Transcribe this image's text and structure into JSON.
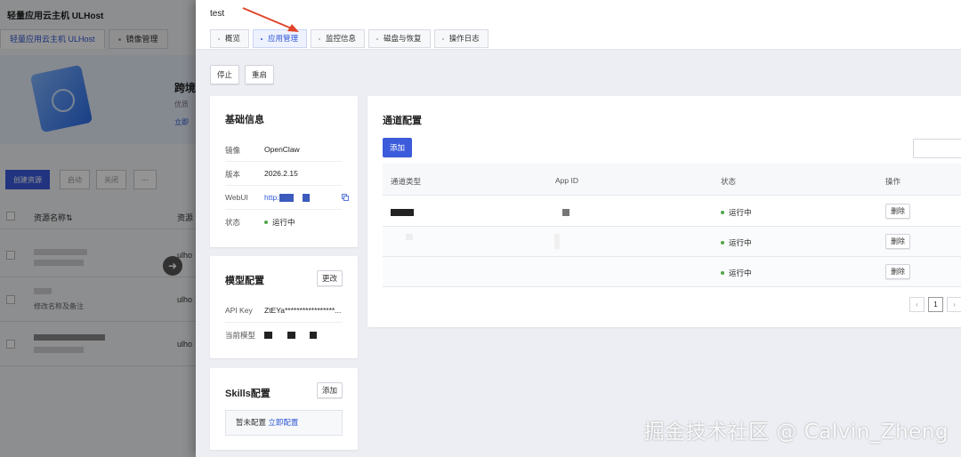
{
  "background": {
    "app_title": "轻量应用云主机 ULHost",
    "tabs": [
      "轻量应用云主机 ULHost",
      "镜像管理"
    ],
    "banner": {
      "title": "跨境",
      "subtitle": "优质",
      "link": "立即"
    },
    "buttons": {
      "create": "创建资源",
      "start": "启动",
      "stop": "关闭",
      "more": "···"
    },
    "table": {
      "col_name": "资源名称",
      "col_sort_icon": "⇅",
      "col_second": "资源",
      "row_values": [
        "ulho",
        "ulho",
        "ulho"
      ],
      "row_subtexts": [
        "",
        "修改名称及备注",
        ""
      ]
    }
  },
  "drawer": {
    "title": "test",
    "tabs": [
      {
        "label": "概览",
        "active": false
      },
      {
        "label": "应用管理",
        "active": true
      },
      {
        "label": "监控信息",
        "active": false
      },
      {
        "label": "磁盘与恢复",
        "active": false
      },
      {
        "label": "操作日志",
        "active": false
      }
    ],
    "actions": {
      "stop": "停止",
      "restart": "重启"
    },
    "basic_info": {
      "title": "基础信息",
      "rows": [
        {
          "key": "镜像",
          "value": "OpenClaw"
        },
        {
          "key": "版本",
          "value": "2026.2.15"
        },
        {
          "key": "WebUI",
          "value": "http:"
        },
        {
          "key": "状态",
          "value": "运行中"
        }
      ]
    },
    "model_config": {
      "title": "模型配置",
      "edit_button": "更改",
      "rows": [
        {
          "key": "API Key",
          "value": "ZtEYa*****************..."
        },
        {
          "key": "当前模型",
          "value": ""
        }
      ]
    },
    "skills_config": {
      "title": "Skills配置",
      "add_button": "添加",
      "empty_text": "暂未配置",
      "empty_link": "立即配置"
    },
    "channel_config": {
      "title": "通道配置",
      "add_button": "添加",
      "columns": [
        "通道类型",
        "App ID",
        "状态",
        "操作"
      ],
      "rows": [
        {
          "status": "运行中",
          "action": "删除"
        },
        {
          "status": "运行中",
          "action": "删除"
        },
        {
          "status": "运行中",
          "action": "删除"
        }
      ],
      "pagination": {
        "prev": "‹",
        "current": "1",
        "next": "›"
      }
    }
  },
  "watermark": "掘金技术社区 @ Calvin_Zheng",
  "colors": {
    "primary": "#3b5bdb",
    "link": "#2f57d3",
    "status_green": "#52a64a",
    "arrow_red": "#e0452b"
  }
}
